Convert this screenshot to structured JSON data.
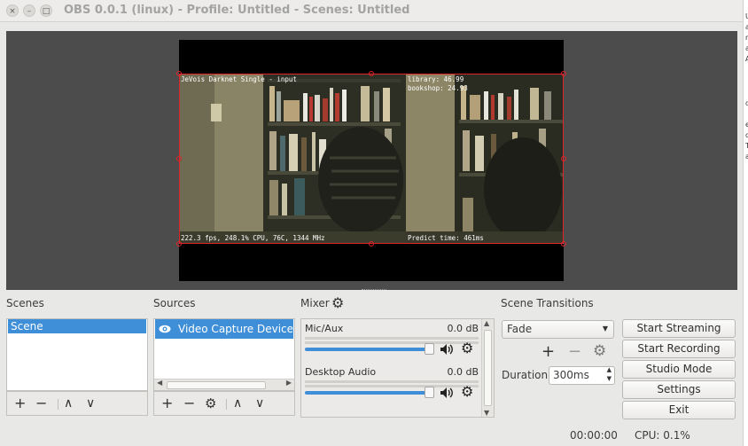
{
  "window": {
    "title": "OBS 0.0.1 (linux) - Profile: Untitled - Scenes: Untitled",
    "controls": {
      "close": "×",
      "minimize": "–",
      "maximize": "□"
    }
  },
  "side_strip_chars": [
    "U",
    "a",
    "n",
    "a",
    "A",
    "d",
    "e",
    "c",
    "T",
    "a"
  ],
  "preview": {
    "overlay_left_top": "JeVois Darknet Single - input",
    "overlay_left_bottom": "222.3 fps, 248.1% CPU, 76C, 1344 MHz",
    "overlay_right_top": "library: 46.99",
    "overlay_right_top2": "bookshop: 24.93",
    "overlay_right_bottom": "Predict time: 461ms",
    "border_color": "#e0232a"
  },
  "scenes": {
    "title": "Scenes",
    "items": [
      "Scene"
    ],
    "selected": 0
  },
  "sources": {
    "title": "Sources",
    "items": [
      {
        "label": "Video Capture Device (V",
        "visible_icon": "eye-icon"
      }
    ]
  },
  "mixer": {
    "title": "Mixer",
    "channels": [
      {
        "name": "Mic/Aux",
        "db": "0.0 dB",
        "volume_fraction": 1.0
      },
      {
        "name": "Desktop Audio",
        "db": "0.0 dB",
        "volume_fraction": 1.0
      }
    ]
  },
  "transitions": {
    "title": "Scene Transitions",
    "selected": "Fade",
    "duration_label": "Duration",
    "duration_value": "300ms"
  },
  "controls": {
    "start_streaming": "Start Streaming",
    "start_recording": "Start Recording",
    "studio_mode": "Studio Mode",
    "settings": "Settings",
    "exit": "Exit"
  },
  "toolbar_glyphs": {
    "add": "+",
    "remove": "−",
    "up": "∧",
    "down": "∨",
    "gear": "⚙"
  },
  "status": {
    "time": "00:00:00",
    "cpu": "CPU: 0.1%"
  },
  "colors": {
    "accent": "#3e8ed8",
    "selection": "#e0232a"
  }
}
